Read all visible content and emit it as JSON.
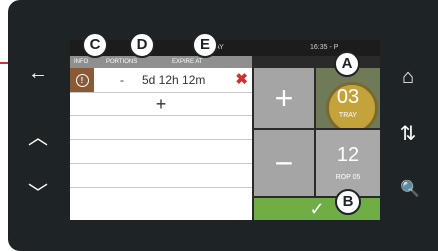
{
  "side_left": {
    "back": "←",
    "up": "︿",
    "down": "﹀"
  },
  "side_right": {
    "home": "⌂",
    "sort": "⇅",
    "search": "🔍"
  },
  "topbar": {
    "title": "AY",
    "time": "16:35 - P"
  },
  "columns": {
    "info": "INFO",
    "portions": "PORTIONS",
    "expire": "EXPIRE AT"
  },
  "entry": {
    "portions": "-",
    "expire": "5d 12h 12m",
    "delete": "✖"
  },
  "add_row": "+",
  "keys": {
    "plus": "+",
    "minus": "−",
    "confirm": "✓"
  },
  "tray_tile": {
    "number": "03",
    "label": "TRAY"
  },
  "count_tile": {
    "number": "12",
    "label": "ROP 05"
  },
  "callouts": {
    "a": "A",
    "b": "B",
    "c": "C",
    "d": "D",
    "e": "E"
  },
  "colors": {
    "confirm": "#6fae45",
    "delete": "#d32f2f",
    "info": "#8a5a36"
  }
}
